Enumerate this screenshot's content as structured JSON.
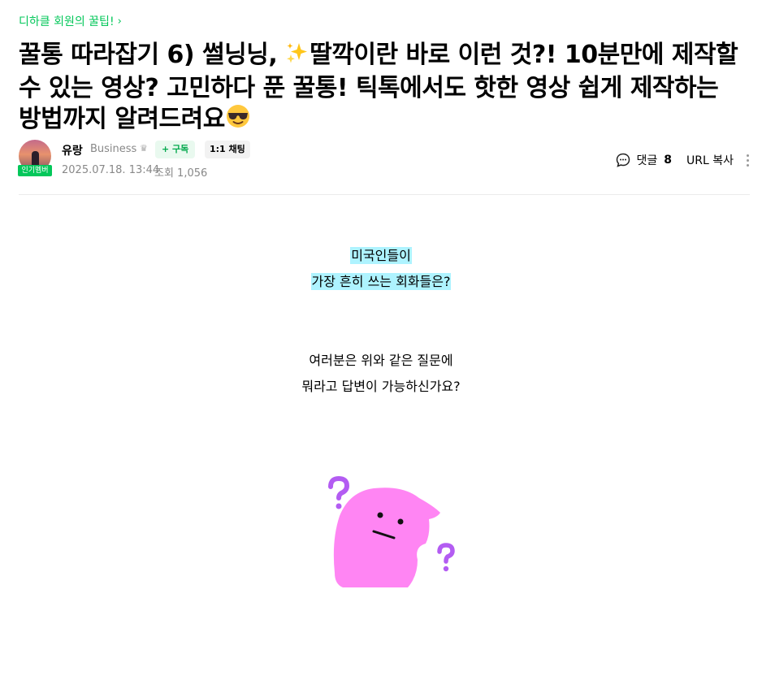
{
  "category": {
    "label": "디하클 회원의 꿀팁!",
    "chevron": "›"
  },
  "title": {
    "part1": "꿀통 따라잡기 6) 썰닝닝, ",
    "emoji1": "sparkles-emoji",
    "part2": "딸깍이란 바로 이런 것?! 10분만에 제작할 수 있는 영상? 고민하다 푼 꿀통! 틱톡에서도 핫한 영상 쉽게 제작하는 방법까지 알려드려요",
    "emoji2": "sunglasses-face-emoji"
  },
  "author": {
    "name": "유랑",
    "grade": "Business",
    "badge": "인기멤버",
    "subscribe_label": "+ 구독",
    "chat_label": "1:1 채팅",
    "date": "2025.07.18. 13:44",
    "views": "조회 1,056"
  },
  "tools": {
    "comment_label": "댓글",
    "comment_count": "8",
    "url_copy_label": "URL 복사"
  },
  "content": {
    "question_line1": "미국인들이",
    "question_line2": "가장 흔히 쓰는 회화들은?",
    "answer_line1": "여러분은 위와 같은 질문에",
    "answer_line2": "뭐라고 답변이 가능하신가요?"
  },
  "colors": {
    "accent": "#03c75a",
    "highlight": "#aef3ff",
    "character": "#ff85f3",
    "question_mark": "#b35cf2"
  }
}
